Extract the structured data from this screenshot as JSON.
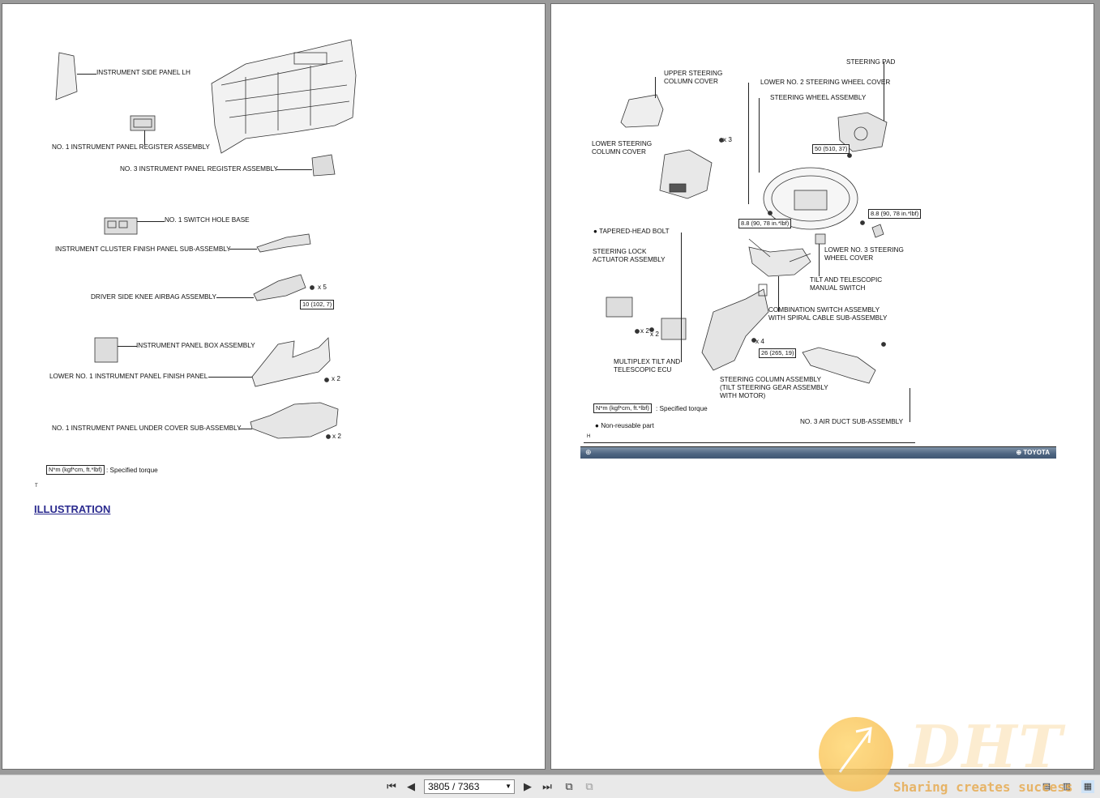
{
  "left_page": {
    "labels": {
      "side_panel": "INSTRUMENT SIDE PANEL LH",
      "register1": "NO. 1 INSTRUMENT PANEL REGISTER ASSEMBLY",
      "register3": "NO. 3 INSTRUMENT PANEL REGISTER ASSEMBLY",
      "switch_hole": "NO. 1 SWITCH HOLE BASE",
      "cluster_panel": "INSTRUMENT CLUSTER FINISH PANEL SUB-ASSEMBLY",
      "knee_airbag": "DRIVER SIDE KNEE AIRBAG ASSEMBLY",
      "box": "INSTRUMENT PANEL BOX ASSEMBLY",
      "lower_finish": "LOWER NO. 1 INSTRUMENT PANEL FINISH PANEL",
      "under_cover": "NO. 1 INSTRUMENT PANEL UNDER COVER SUB-ASSEMBLY"
    },
    "counts": {
      "knee_x": "x 5",
      "lower_x": "x 2",
      "under_x": "x 2"
    },
    "torque_knee": "10 (102, 7)",
    "legend_box": "N*m (kgf*cm, ft.*lbf)",
    "legend_text": ": Specified torque",
    "small_mark": "T",
    "illustration_link": "ILLUSTRATION"
  },
  "right_page": {
    "labels": {
      "steering_pad": "STEERING PAD",
      "upper_cover": "UPPER STEERING\nCOLUMN COVER",
      "lower_no2": "LOWER NO. 2 STEERING WHEEL COVER",
      "wheel_assembly": "STEERING WHEEL ASSEMBLY",
      "lower_column_cover": "LOWER STEERING\nCOLUMN COVER",
      "tapered_bolt": "TAPERED-HEAD BOLT",
      "lock_actuator": "STEERING LOCK\nACTUATOR ASSEMBLY",
      "lower_no3": "LOWER NO. 3 STEERING\nWHEEL COVER",
      "tilt_switch": "TILT AND TELESCOPIC\nMANUAL SWITCH",
      "combination_switch": "COMBINATION SWITCH ASSEMBLY\nWITH SPIRAL CABLE SUB-ASSEMBLY",
      "multiplex_ecu": "MULTIPLEX TILT AND\nTELESCOPIC ECU",
      "steering_column": "STEERING COLUMN ASSEMBLY\n(TILT STEERING GEAR ASSEMBLY\nWITH MOTOR)",
      "air_duct": "NO. 3 AIR DUCT SUB-ASSEMBLY"
    },
    "counts": {
      "upper_x": "x 3",
      "bolt_x": "x 2",
      "bolt_x2": "x 2",
      "column_x": "x 4"
    },
    "torques": {
      "pad": "50 (510, 37)",
      "wheel_left": "8.8 (90, 78 in.*lbf)",
      "wheel_right": "8.8 (90, 78 in.*lbf)",
      "column": "26 (265, 19)"
    },
    "legend_box": "N*m (kgf*cm, ft.*lbf)",
    "legend_text": ": Specified torque",
    "nonreusable": "Non-reusable part",
    "small_mark": "H",
    "toyota_text": "TOYOTA"
  },
  "toolbar": {
    "page_indicator": "3805 / 7363",
    "icons": [
      "first-page-icon",
      "prev-page-icon",
      "next-page-icon",
      "last-page-icon",
      "fit-page-icon",
      "fit-width-icon"
    ]
  },
  "watermark": {
    "brand": "DHT",
    "slogan": "Sharing creates success"
  }
}
